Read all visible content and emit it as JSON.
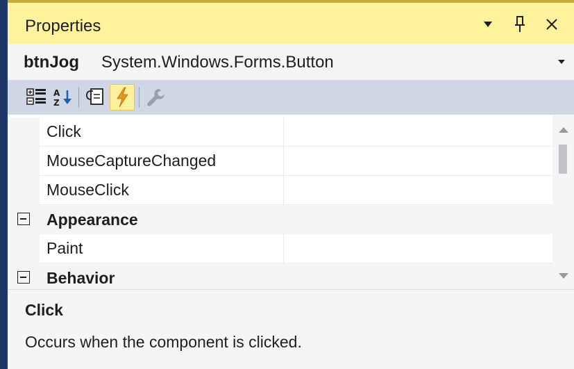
{
  "window": {
    "title": "Properties",
    "controls": [
      {
        "name": "window-position-dropdown",
        "glyph": "▾"
      },
      {
        "name": "pin-icon",
        "glyph": "ᛒ"
      },
      {
        "name": "close-icon",
        "glyph": "✕"
      }
    ]
  },
  "object_selector": {
    "name": "btnJog",
    "type": "System.Windows.Forms.Button"
  },
  "toolbar": {
    "buttons": [
      {
        "name": "categorized-icon",
        "active": false
      },
      {
        "name": "alphabetical-icon",
        "active": false
      },
      {
        "name": "properties-page-icon",
        "active": false
      },
      {
        "name": "events-lightning-icon",
        "active": true
      },
      {
        "name": "property-pages-wrench-icon",
        "active": false
      }
    ]
  },
  "grid": {
    "rows": [
      {
        "kind": "item",
        "label": "Click",
        "value": ""
      },
      {
        "kind": "item",
        "label": "MouseCaptureChanged",
        "value": ""
      },
      {
        "kind": "item",
        "label": "MouseClick",
        "value": ""
      },
      {
        "kind": "category",
        "label": "Appearance",
        "expanded": true
      },
      {
        "kind": "item",
        "label": "Paint",
        "value": ""
      },
      {
        "kind": "category",
        "label": "Behavior",
        "expanded": true
      }
    ]
  },
  "description": {
    "title": "Click",
    "text": "Occurs when the component is clicked."
  },
  "colors": {
    "title_bar": "#fff29d",
    "toolbar": "#cfd6e5",
    "active_button": "#fff29d",
    "frame": "#1f3766",
    "lightning": "#e8961e"
  }
}
